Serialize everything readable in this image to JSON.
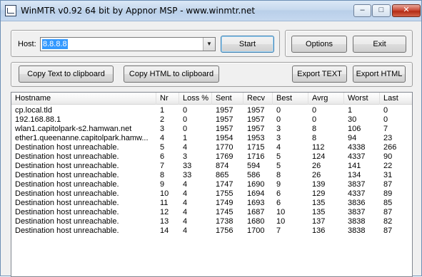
{
  "window": {
    "title": "WinMTR v0.92 64 bit by Appnor MSP - www.winmtr.net",
    "controls": {
      "minimize": "–",
      "maximize": "□",
      "close": "✕"
    }
  },
  "host": {
    "label": "Host:",
    "value": "8.8.8.8",
    "start_label": "Start"
  },
  "options_label": "Options",
  "exit_label": "Exit",
  "toolbar": {
    "copy_text": "Copy Text to clipboard",
    "copy_html": "Copy HTML to clipboard",
    "export_text": "Export TEXT",
    "export_html": "Export HTML"
  },
  "table": {
    "columns": [
      "Hostname",
      "Nr",
      "Loss %",
      "Sent",
      "Recv",
      "Best",
      "Avrg",
      "Worst",
      "Last"
    ],
    "rows": [
      [
        "cp.local.tld",
        "1",
        "0",
        "1957",
        "1957",
        "0",
        "0",
        "1",
        "0"
      ],
      [
        "192.168.88.1",
        "2",
        "0",
        "1957",
        "1957",
        "0",
        "0",
        "30",
        "0"
      ],
      [
        "wlan1.capitolpark-s2.hamwan.net",
        "3",
        "0",
        "1957",
        "1957",
        "3",
        "8",
        "106",
        "7"
      ],
      [
        "ether1.queenanne.capitolpark.hamw...",
        "4",
        "1",
        "1954",
        "1953",
        "3",
        "8",
        "94",
        "23"
      ],
      [
        "Destination host unreachable.",
        "5",
        "4",
        "1770",
        "1715",
        "4",
        "112",
        "4338",
        "266"
      ],
      [
        "Destination host unreachable.",
        "6",
        "3",
        "1769",
        "1716",
        "5",
        "124",
        "4337",
        "90"
      ],
      [
        "Destination host unreachable.",
        "7",
        "33",
        "874",
        "594",
        "5",
        "26",
        "141",
        "22"
      ],
      [
        "Destination host unreachable.",
        "8",
        "33",
        "865",
        "586",
        "8",
        "26",
        "134",
        "31"
      ],
      [
        "Destination host unreachable.",
        "9",
        "4",
        "1747",
        "1690",
        "9",
        "139",
        "3837",
        "87"
      ],
      [
        "Destination host unreachable.",
        "10",
        "4",
        "1755",
        "1694",
        "6",
        "129",
        "4337",
        "89"
      ],
      [
        "Destination host unreachable.",
        "11",
        "4",
        "1749",
        "1693",
        "6",
        "135",
        "3836",
        "85"
      ],
      [
        "Destination host unreachable.",
        "12",
        "4",
        "1745",
        "1687",
        "10",
        "135",
        "3837",
        "87"
      ],
      [
        "Destination host unreachable.",
        "13",
        "4",
        "1738",
        "1680",
        "10",
        "137",
        "3838",
        "82"
      ],
      [
        "Destination host unreachable.",
        "14",
        "4",
        "1756",
        "1700",
        "7",
        "136",
        "3838",
        "87"
      ]
    ]
  }
}
